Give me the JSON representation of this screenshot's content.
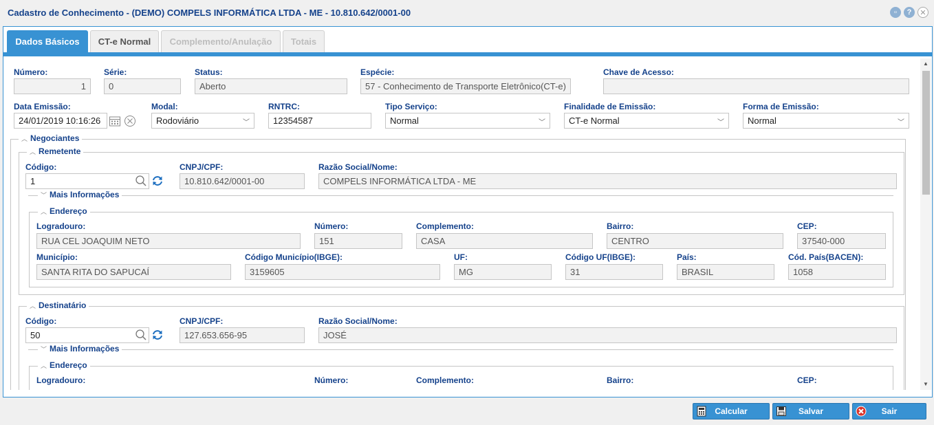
{
  "window": {
    "title": "Cadastro de Conhecimento - (DEMO) COMPELS INFORMÁTICA LTDA - ME - 10.810.642/0001-00"
  },
  "tabs": [
    {
      "label": "Dados Básicos",
      "state": "active"
    },
    {
      "label": "CT-e Normal",
      "state": "normal"
    },
    {
      "label": "Complemento/Anulação",
      "state": "disabled"
    },
    {
      "label": "Totais",
      "state": "disabled"
    }
  ],
  "header": {
    "numero_label": "Número:",
    "numero_value": "1",
    "serie_label": "Série:",
    "serie_value": "0",
    "status_label": "Status:",
    "status_value": "Aberto",
    "especie_label": "Espécie:",
    "especie_value": "57 - Conhecimento de Transporte Eletrônico(CT-e)",
    "chave_label": "Chave de Acesso:",
    "chave_value": "",
    "data_label": "Data Emissão:",
    "data_value": "24/01/2019 10:16:26",
    "modal_label": "Modal:",
    "modal_value": "Rodoviário",
    "rntrc_label": "RNTRC:",
    "rntrc_value": "12354587",
    "tipo_label": "Tipo Serviço:",
    "tipo_value": "Normal",
    "finalidade_label": "Finalidade de Emissão:",
    "finalidade_value": "CT-e Normal",
    "forma_label": "Forma de Emissão:",
    "forma_value": "Normal"
  },
  "negociantes": {
    "title": "Negociantes",
    "mais_info": "Mais Informações",
    "endereco": "Endereço",
    "codigo_label": "Código:",
    "cnpj_label": "CNPJ/CPF:",
    "razao_label": "Razão Social/Nome:",
    "logradouro_label": "Logradouro:",
    "numero_label": "Número:",
    "complemento_label": "Complemento:",
    "bairro_label": "Bairro:",
    "cep_label": "CEP:",
    "municipio_label": "Município:",
    "cod_municipio_label": "Código Município(IBGE):",
    "uf_label": "UF:",
    "cod_uf_label": "Código UF(IBGE):",
    "pais_label": "País:",
    "cod_pais_label": "Cód. País(BACEN):",
    "remetente": {
      "title": "Remetente",
      "codigo": "1",
      "cnpj": "10.810.642/0001-00",
      "razao": "COMPELS INFORMÁTICA LTDA - ME",
      "logradouro": "RUA CEL JOAQUIM NETO",
      "numero": "151",
      "complemento": "CASA",
      "bairro": "CENTRO",
      "cep": "37540-000",
      "municipio": "SANTA RITA DO SAPUCAÍ",
      "cod_municipio": "3159605",
      "uf": "MG",
      "cod_uf": "31",
      "pais": "BRASIL",
      "cod_pais": "1058"
    },
    "destinatario": {
      "title": "Destinatário",
      "codigo": "50",
      "cnpj": "127.653.656-95",
      "razao": "JOSÉ"
    }
  },
  "footer": {
    "calcular": "Calcular",
    "salvar": "Salvar",
    "sair": "Sair"
  },
  "colors": {
    "accent": "#3892d3",
    "label": "#15428b"
  }
}
